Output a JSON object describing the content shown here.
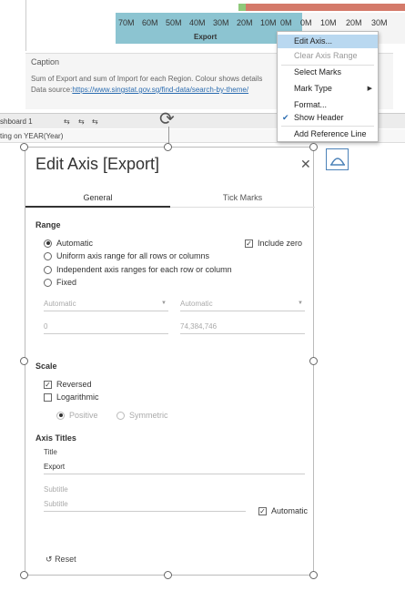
{
  "chart": {
    "ticks_left": [
      "70M",
      "60M",
      "50M",
      "40M",
      "30M",
      "20M",
      "10M",
      "0M"
    ],
    "ticks_right": [
      "0M",
      "10M",
      "20M",
      "30M"
    ],
    "axis_label": "Export"
  },
  "caption": {
    "title": "Caption",
    "text": "Sum of Export and sum of Import for each Region.  Colour shows details",
    "source_prefix": "Data source:",
    "source_link": "https://www.singstat.gov.sg/find-data/search-by-theme/"
  },
  "tabstrip": {
    "sheet": "shboard 1"
  },
  "filterbar": {
    "text": "ting on YEAR(Year)"
  },
  "context_menu": {
    "items": [
      "Edit Axis...",
      "Clear Axis Range",
      "Select Marks",
      "Mark Type",
      "Format...",
      "Show Header",
      "Add Reference Line"
    ]
  },
  "dialog": {
    "title": "Edit Axis [Export]",
    "tabs": [
      "General",
      "Tick Marks"
    ],
    "range": {
      "label": "Range",
      "options": [
        "Automatic",
        "Uniform axis range for all rows or columns",
        "Independent axis ranges for each row or column",
        "Fixed"
      ],
      "selected": "Automatic",
      "include_zero": "Include zero",
      "start_mode": "Automatic",
      "end_mode": "Automatic",
      "start_value": "0",
      "end_value": "74,384,746"
    },
    "scale": {
      "label": "Scale",
      "reversed": "Reversed",
      "logarithmic": "Logarithmic",
      "positive": "Positive",
      "symmetric": "Symmetric"
    },
    "axis_titles": {
      "label": "Axis Titles",
      "title_label": "Title",
      "title_value": "Export",
      "subtitle_label": "Subtitle",
      "subtitle_placeholder": "Subtitle",
      "automatic": "Automatic"
    },
    "reset": "Reset"
  },
  "colors": {
    "accent": "#8cc4d1",
    "menu_highlight": "#b9d8f0",
    "link": "#2b6cb0"
  }
}
